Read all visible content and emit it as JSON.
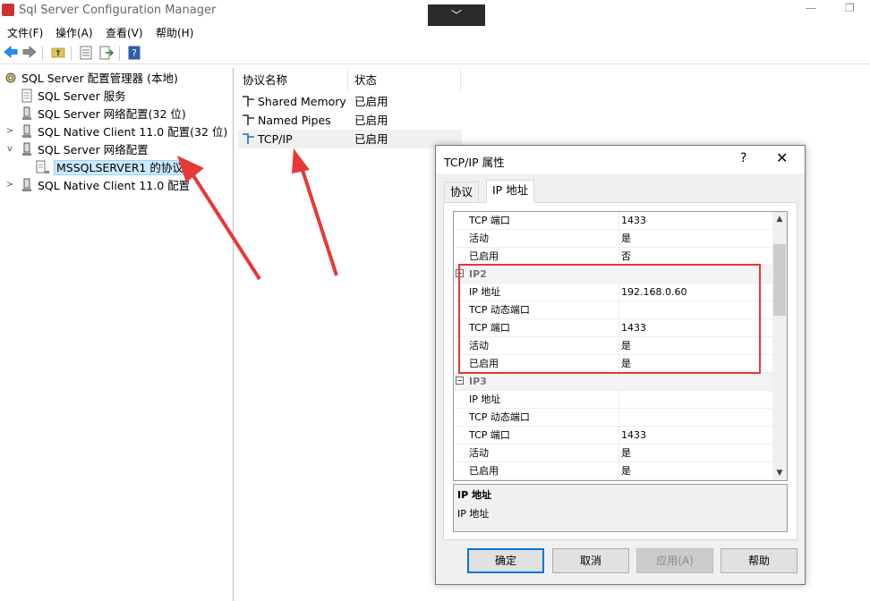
{
  "window": {
    "title": "Sql Server Configuration Manager",
    "dropdown_glyph": "﹀",
    "minimize_glyph": "—",
    "restore_glyph": "❐"
  },
  "menu": [
    "文件(F)",
    "操作(A)",
    "查看(V)",
    "帮助(H)"
  ],
  "toolbar": {
    "icons": [
      "back-icon",
      "forward-icon",
      "up-folder-icon",
      "properties-icon",
      "export-icon",
      "help-icon"
    ]
  },
  "tree": {
    "root": "SQL Server 配置管理器 (本地)",
    "items": [
      {
        "label": "SQL Server 服务"
      },
      {
        "label": "SQL Server 网络配置(32 位)"
      },
      {
        "label": "SQL Native Client 11.0 配置(32 位)"
      },
      {
        "label": "SQL Server 网络配置"
      },
      {
        "label": "MSSQLSERVER1 的协议"
      },
      {
        "label": "SQL Native Client 11.0 配置"
      }
    ]
  },
  "list": {
    "columns": [
      "协议名称",
      "状态"
    ],
    "rows": [
      {
        "name": "Shared Memory",
        "state": "已启用"
      },
      {
        "name": "Named Pipes",
        "state": "已启用"
      },
      {
        "name": "TCP/IP",
        "state": "已启用"
      }
    ]
  },
  "dialog": {
    "title": "TCP/IP 属性",
    "help": "?",
    "close": "✕",
    "tabs": [
      "协议",
      "IP 地址"
    ],
    "grid": [
      {
        "k": "TCP 端口",
        "v": "1433"
      },
      {
        "k": "活动",
        "v": "是"
      },
      {
        "k": "已启用",
        "v": "否"
      },
      {
        "cat": "IP2"
      },
      {
        "k": "IP 地址",
        "v": "192.168.0.60"
      },
      {
        "k": "TCP 动态端口",
        "v": ""
      },
      {
        "k": "TCP 端口",
        "v": "1433"
      },
      {
        "k": "活动",
        "v": "是"
      },
      {
        "k": "已启用",
        "v": "是"
      },
      {
        "cat": "IP3"
      },
      {
        "k": "IP 地址",
        "v": ""
      },
      {
        "k": "TCP 动态端口",
        "v": ""
      },
      {
        "k": "TCP 端口",
        "v": "1433"
      },
      {
        "k": "活动",
        "v": "是"
      },
      {
        "k": "已启用",
        "v": "是"
      }
    ],
    "description": {
      "title": "IP 地址",
      "text": "IP 地址"
    },
    "buttons": {
      "ok": "确定",
      "cancel": "取消",
      "apply": "应用(A)",
      "help": "帮助"
    }
  },
  "colors": {
    "annotation": "#e53935",
    "selection": "#cce8ff",
    "default_button_border": "#0078d7"
  }
}
